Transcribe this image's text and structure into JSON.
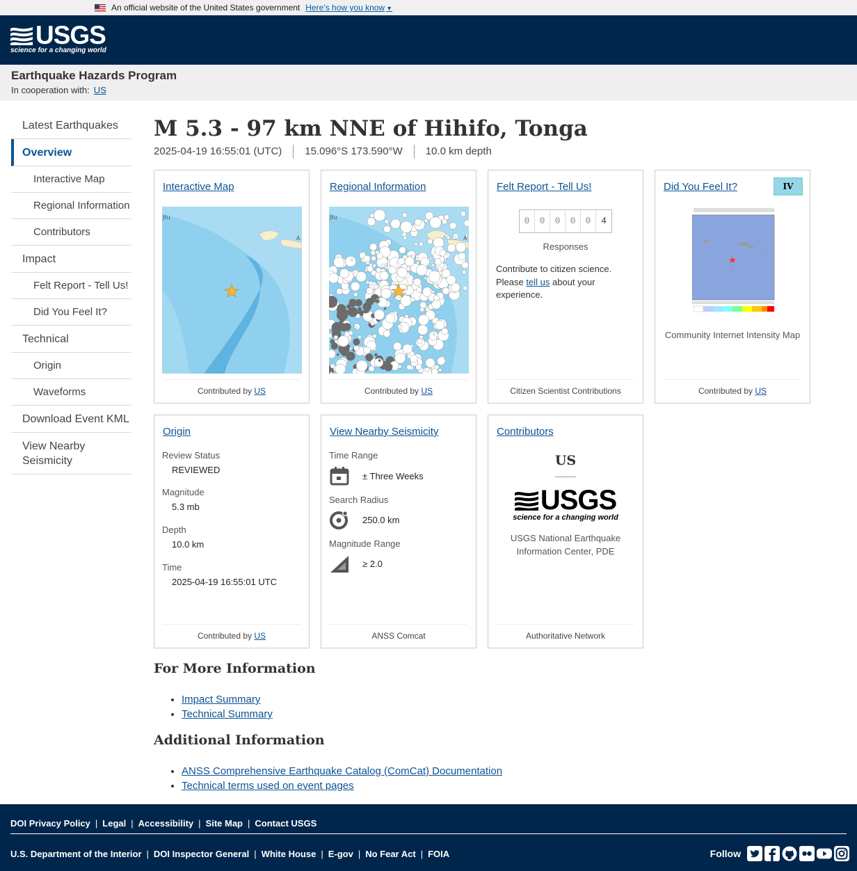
{
  "gov_banner": {
    "text": "An official website of the United States government",
    "link": "Here’s how you know"
  },
  "header": {
    "logo_text": "USGS",
    "logo_tagline": "science for a changing world"
  },
  "program": {
    "title": "Earthquake Hazards Program",
    "coop_label": "In cooperation with:",
    "coop_link": "US"
  },
  "sidebar": {
    "items": [
      {
        "label": "Latest Earthquakes",
        "level": 0,
        "active": false
      },
      {
        "label": "Overview",
        "level": 0,
        "active": true
      },
      {
        "label": "Interactive Map",
        "level": 1
      },
      {
        "label": "Regional Information",
        "level": 1
      },
      {
        "label": "Contributors",
        "level": 1
      },
      {
        "label": "Impact",
        "level": 0
      },
      {
        "label": "Felt Report - Tell Us!",
        "level": 1
      },
      {
        "label": "Did You Feel It?",
        "level": 1
      },
      {
        "label": "Technical",
        "level": 0
      },
      {
        "label": "Origin",
        "level": 1
      },
      {
        "label": "Waveforms",
        "level": 1
      },
      {
        "label": "Download Event KML",
        "level": 0
      },
      {
        "label": "View Nearby Seismicity",
        "level": 0
      }
    ]
  },
  "event": {
    "title": "M 5.3 - 97 km NNE of Hihifo, Tonga",
    "time": "2025-04-19 16:55:01 (UTC)",
    "location": "15.096°S 173.590°W",
    "depth": "10.0 km depth"
  },
  "cards": {
    "interactive_map": {
      "title": "Interactive Map",
      "contributed_label": "Contributed by",
      "contributor": "US",
      "map_label_left": "Jtu",
      "map_label_right": "A"
    },
    "regional": {
      "title": "Regional Information",
      "contributed_label": "Contributed by",
      "contributor": "US",
      "map_label_left": "Jtu",
      "map_label_right": "A"
    },
    "felt_report": {
      "title": "Felt Report - Tell Us!",
      "digits": [
        "0",
        "0",
        "0",
        "0",
        "0",
        "4"
      ],
      "responses_label": "Responses",
      "text_before": "Contribute to citizen science. Please",
      "text_link": "tell us",
      "text_after": "about your experience.",
      "footer": "Citizen Scientist Contributions"
    },
    "dyfi": {
      "title": "Did You Feel It?",
      "badge": "IV",
      "caption": "Community Internet Intensity Map",
      "contributed_label": "Contributed by",
      "contributor": "US"
    },
    "origin": {
      "title": "Origin",
      "review_label": "Review Status",
      "review_value": "REVIEWED",
      "magnitude_label": "Magnitude",
      "magnitude_value": "5.3 mb",
      "depth_label": "Depth",
      "depth_value": "10.0 km",
      "time_label": "Time",
      "time_value": "2025-04-19 16:55:01 UTC",
      "contributed_label": "Contributed by",
      "contributor": "US"
    },
    "nearby": {
      "title": "View Nearby Seismicity",
      "time_range_label": "Time Range",
      "time_range_value": "± Three Weeks",
      "radius_label": "Search Radius",
      "radius_value": "250.0 km",
      "mag_label": "Magnitude Range",
      "mag_value": "≥ 2.0",
      "footer": "ANSS Comcat"
    },
    "contributors": {
      "title": "Contributors",
      "network": "US",
      "logo_text": "USGS",
      "logo_tagline": "science for a changing world",
      "description": "USGS National Earthquake Information Center, PDE",
      "footer": "Authoritative Network"
    }
  },
  "more_info": {
    "heading": "For More Information",
    "links": [
      "Impact Summary",
      "Technical Summary"
    ]
  },
  "additional": {
    "heading": "Additional Information",
    "links": [
      "ANSS Comprehensive Earthquake Catalog (ComCat) Documentation",
      "Technical terms used on event pages"
    ]
  },
  "footer": {
    "row1": [
      "DOI Privacy Policy",
      "Legal",
      "Accessibility",
      "Site Map",
      "Contact USGS"
    ],
    "row2": [
      "U.S. Department of the Interior",
      "DOI Inspector General",
      "White House",
      "E-gov",
      "No Fear Act",
      "FOIA"
    ],
    "follow_label": "Follow",
    "social_icons": [
      "twitter-icon",
      "facebook-icon",
      "github-icon",
      "flickr-icon",
      "youtube-icon",
      "instagram-icon"
    ]
  },
  "colors": {
    "header_bg": "#00264c",
    "link": "#0b5394",
    "badge_iv": "#95d7e6"
  }
}
